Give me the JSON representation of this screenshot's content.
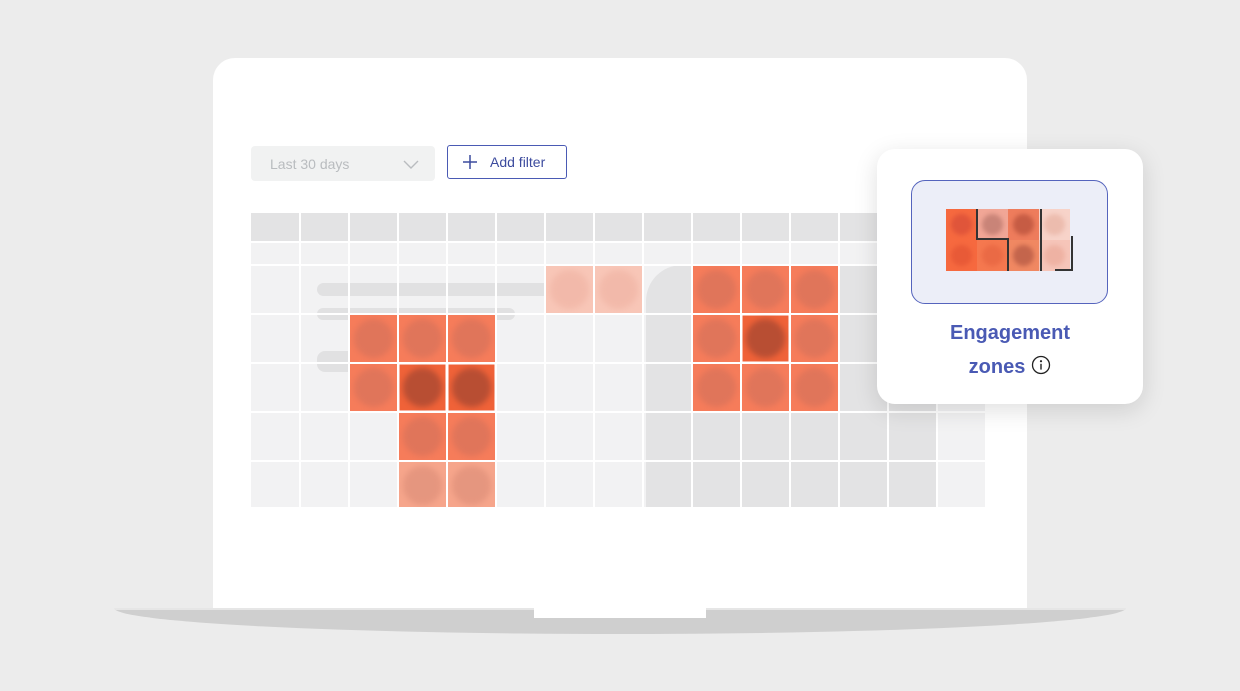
{
  "filters": {
    "date_range": "Last 30 days",
    "add_filter_label": "Add filter"
  },
  "engagement_card": {
    "title_line1": "Engagement",
    "title_line2": "zones"
  },
  "icons": [
    "chevron-down-icon",
    "plus-icon",
    "info-icon"
  ],
  "colors": {
    "accent": "#4a5ab4",
    "heat_strong": "#f4603a",
    "heat_light": "#f8bfae",
    "heat_core": "#b95038"
  }
}
